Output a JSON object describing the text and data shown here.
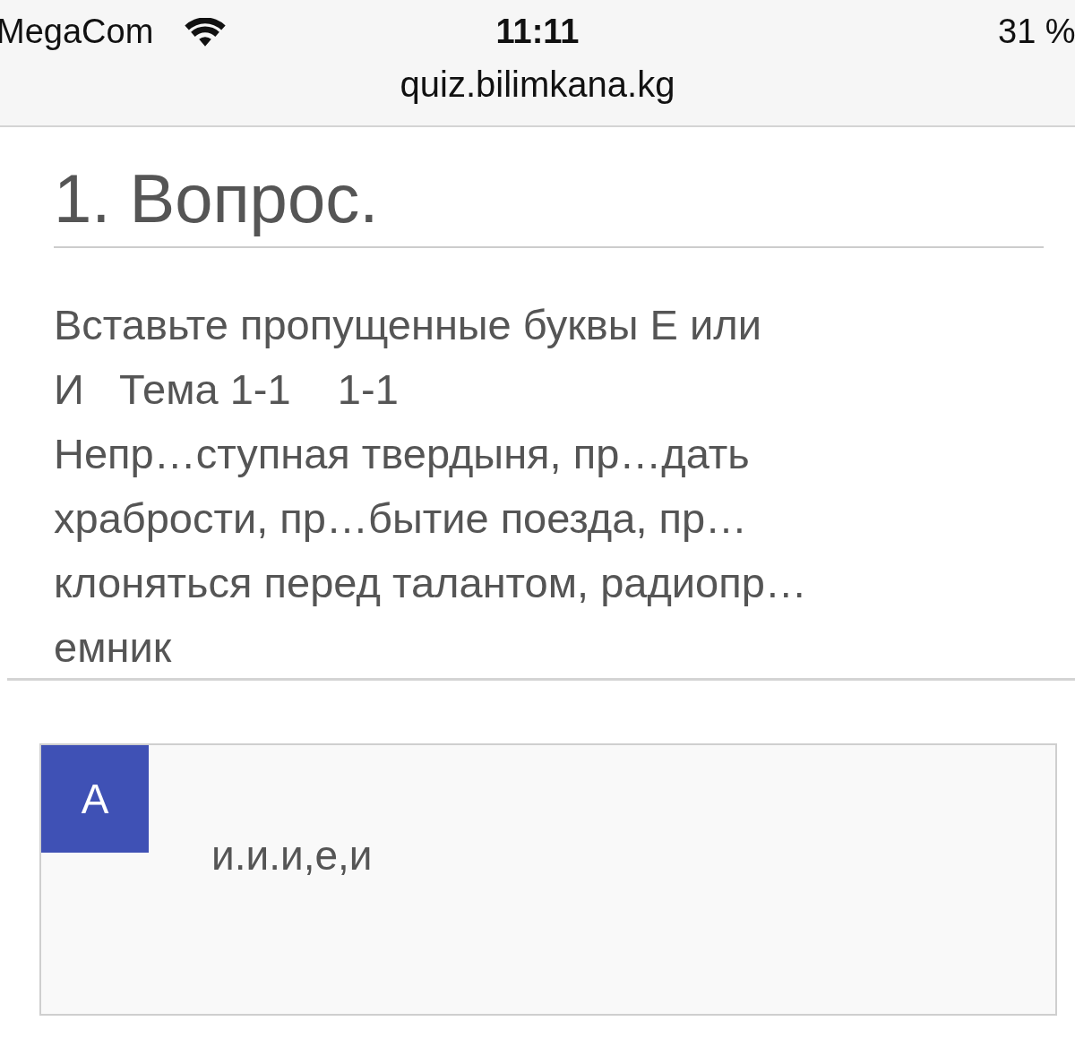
{
  "status_bar": {
    "carrier": "MegaCom",
    "time": "11:11",
    "battery": "31 %"
  },
  "address_bar": {
    "url": "quiz.bilimkana.kg"
  },
  "question": {
    "heading": "1. Вопрос.",
    "text": "Вставьте пропущенные буквы Е или\nИ   Тема 1-1    1-1\nНепр…ступная твердыня, пр…дать\nхрабрости, пр…бытие поезда, пр…\nклоняться перед талантом, радиопр…\nемник"
  },
  "answers": [
    {
      "letter": "A",
      "text": "и.и.и,е,и"
    }
  ]
}
